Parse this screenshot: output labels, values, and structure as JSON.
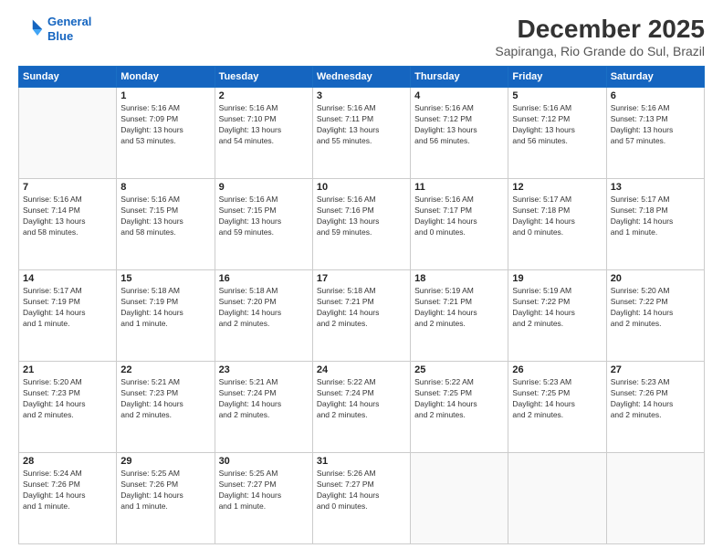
{
  "logo": {
    "line1": "General",
    "line2": "Blue"
  },
  "title": "December 2025",
  "subtitle": "Sapiranga, Rio Grande do Sul, Brazil",
  "days_of_week": [
    "Sunday",
    "Monday",
    "Tuesday",
    "Wednesday",
    "Thursday",
    "Friday",
    "Saturday"
  ],
  "weeks": [
    [
      {
        "day": "",
        "info": ""
      },
      {
        "day": "1",
        "info": "Sunrise: 5:16 AM\nSunset: 7:09 PM\nDaylight: 13 hours\nand 53 minutes."
      },
      {
        "day": "2",
        "info": "Sunrise: 5:16 AM\nSunset: 7:10 PM\nDaylight: 13 hours\nand 54 minutes."
      },
      {
        "day": "3",
        "info": "Sunrise: 5:16 AM\nSunset: 7:11 PM\nDaylight: 13 hours\nand 55 minutes."
      },
      {
        "day": "4",
        "info": "Sunrise: 5:16 AM\nSunset: 7:12 PM\nDaylight: 13 hours\nand 56 minutes."
      },
      {
        "day": "5",
        "info": "Sunrise: 5:16 AM\nSunset: 7:12 PM\nDaylight: 13 hours\nand 56 minutes."
      },
      {
        "day": "6",
        "info": "Sunrise: 5:16 AM\nSunset: 7:13 PM\nDaylight: 13 hours\nand 57 minutes."
      }
    ],
    [
      {
        "day": "7",
        "info": "Sunrise: 5:16 AM\nSunset: 7:14 PM\nDaylight: 13 hours\nand 58 minutes."
      },
      {
        "day": "8",
        "info": "Sunrise: 5:16 AM\nSunset: 7:15 PM\nDaylight: 13 hours\nand 58 minutes."
      },
      {
        "day": "9",
        "info": "Sunrise: 5:16 AM\nSunset: 7:15 PM\nDaylight: 13 hours\nand 59 minutes."
      },
      {
        "day": "10",
        "info": "Sunrise: 5:16 AM\nSunset: 7:16 PM\nDaylight: 13 hours\nand 59 minutes."
      },
      {
        "day": "11",
        "info": "Sunrise: 5:16 AM\nSunset: 7:17 PM\nDaylight: 14 hours\nand 0 minutes."
      },
      {
        "day": "12",
        "info": "Sunrise: 5:17 AM\nSunset: 7:18 PM\nDaylight: 14 hours\nand 0 minutes."
      },
      {
        "day": "13",
        "info": "Sunrise: 5:17 AM\nSunset: 7:18 PM\nDaylight: 14 hours\nand 1 minute."
      }
    ],
    [
      {
        "day": "14",
        "info": "Sunrise: 5:17 AM\nSunset: 7:19 PM\nDaylight: 14 hours\nand 1 minute."
      },
      {
        "day": "15",
        "info": "Sunrise: 5:18 AM\nSunset: 7:19 PM\nDaylight: 14 hours\nand 1 minute."
      },
      {
        "day": "16",
        "info": "Sunrise: 5:18 AM\nSunset: 7:20 PM\nDaylight: 14 hours\nand 2 minutes."
      },
      {
        "day": "17",
        "info": "Sunrise: 5:18 AM\nSunset: 7:21 PM\nDaylight: 14 hours\nand 2 minutes."
      },
      {
        "day": "18",
        "info": "Sunrise: 5:19 AM\nSunset: 7:21 PM\nDaylight: 14 hours\nand 2 minutes."
      },
      {
        "day": "19",
        "info": "Sunrise: 5:19 AM\nSunset: 7:22 PM\nDaylight: 14 hours\nand 2 minutes."
      },
      {
        "day": "20",
        "info": "Sunrise: 5:20 AM\nSunset: 7:22 PM\nDaylight: 14 hours\nand 2 minutes."
      }
    ],
    [
      {
        "day": "21",
        "info": "Sunrise: 5:20 AM\nSunset: 7:23 PM\nDaylight: 14 hours\nand 2 minutes."
      },
      {
        "day": "22",
        "info": "Sunrise: 5:21 AM\nSunset: 7:23 PM\nDaylight: 14 hours\nand 2 minutes."
      },
      {
        "day": "23",
        "info": "Sunrise: 5:21 AM\nSunset: 7:24 PM\nDaylight: 14 hours\nand 2 minutes."
      },
      {
        "day": "24",
        "info": "Sunrise: 5:22 AM\nSunset: 7:24 PM\nDaylight: 14 hours\nand 2 minutes."
      },
      {
        "day": "25",
        "info": "Sunrise: 5:22 AM\nSunset: 7:25 PM\nDaylight: 14 hours\nand 2 minutes."
      },
      {
        "day": "26",
        "info": "Sunrise: 5:23 AM\nSunset: 7:25 PM\nDaylight: 14 hours\nand 2 minutes."
      },
      {
        "day": "27",
        "info": "Sunrise: 5:23 AM\nSunset: 7:26 PM\nDaylight: 14 hours\nand 2 minutes."
      }
    ],
    [
      {
        "day": "28",
        "info": "Sunrise: 5:24 AM\nSunset: 7:26 PM\nDaylight: 14 hours\nand 1 minute."
      },
      {
        "day": "29",
        "info": "Sunrise: 5:25 AM\nSunset: 7:26 PM\nDaylight: 14 hours\nand 1 minute."
      },
      {
        "day": "30",
        "info": "Sunrise: 5:25 AM\nSunset: 7:27 PM\nDaylight: 14 hours\nand 1 minute."
      },
      {
        "day": "31",
        "info": "Sunrise: 5:26 AM\nSunset: 7:27 PM\nDaylight: 14 hours\nand 0 minutes."
      },
      {
        "day": "",
        "info": ""
      },
      {
        "day": "",
        "info": ""
      },
      {
        "day": "",
        "info": ""
      }
    ]
  ]
}
